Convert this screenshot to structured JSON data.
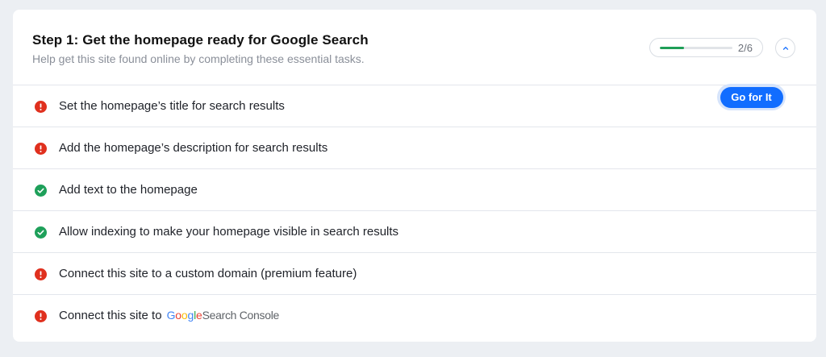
{
  "section": {
    "title": "Step 1: Get the homepage ready for Google Search",
    "subtitle": "Help get this site found online by completing these essential tasks.",
    "progress_text": "2/6",
    "progress_fraction": 0.333
  },
  "tasks": [
    {
      "label": "Set the homepage’s title for search results",
      "status": "incomplete",
      "status_icon": "exclamation-icon"
    },
    {
      "label": "Add the homepage’s description for search results",
      "status": "incomplete",
      "status_icon": "exclamation-icon"
    },
    {
      "label": "Add text to the homepage",
      "status": "complete",
      "status_icon": "checkmark-icon"
    },
    {
      "label": "Allow indexing to make your homepage visible in search results",
      "status": "complete",
      "status_icon": "checkmark-icon"
    },
    {
      "label": "Connect this site to a custom domain (premium feature)",
      "status": "incomplete",
      "status_icon": "exclamation-icon"
    },
    {
      "label": "Connect this site to",
      "status": "incomplete",
      "status_icon": "exclamation-icon"
    }
  ],
  "go_button_label": "Go for It",
  "search_console_logo": {
    "google_letters": [
      "G",
      "o",
      "o",
      "g",
      "l",
      "e"
    ],
    "product_text": "Search Console"
  },
  "colors": {
    "accent": "#116dff",
    "error": "#e0301e",
    "success": "#1ea05a",
    "progress": "#1e9e57",
    "google_blue": "#4285f4",
    "google_red": "#ea4335",
    "google_yellow": "#fbbc05",
    "google_green": "#34a853"
  }
}
